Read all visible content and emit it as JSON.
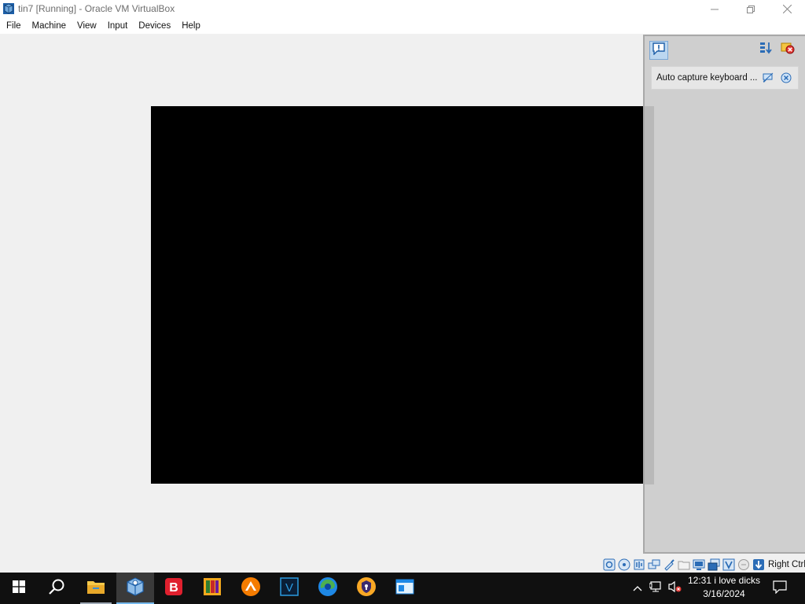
{
  "window": {
    "title": "tin7 [Running] - Oracle VM VirtualBox"
  },
  "menu": [
    "File",
    "Machine",
    "View",
    "Input",
    "Devices",
    "Help"
  ],
  "notification_center": {
    "items": [
      {
        "text": "Auto capture keyboard ..."
      }
    ]
  },
  "statusbar": {
    "icons": [
      "hard-disk-icon",
      "optical-drive-icon",
      "audio-icon",
      "network-icon",
      "usb-icon",
      "shared-folders-icon",
      "display-icon",
      "recording-icon",
      "virtualization-icon",
      "mouse-integration-icon",
      "keyboard-icon"
    ],
    "host_key": "Right Ctrl"
  },
  "taskbar": {
    "apps": [
      "start",
      "search",
      "file-explorer",
      "virtualbox",
      "bitdefender",
      "app-orange",
      "app-round-orange",
      "app-v",
      "edge",
      "app-shield",
      "app-blue-window"
    ],
    "clock_time": "12:31 i love dicks",
    "clock_date": "3/16/2024"
  }
}
